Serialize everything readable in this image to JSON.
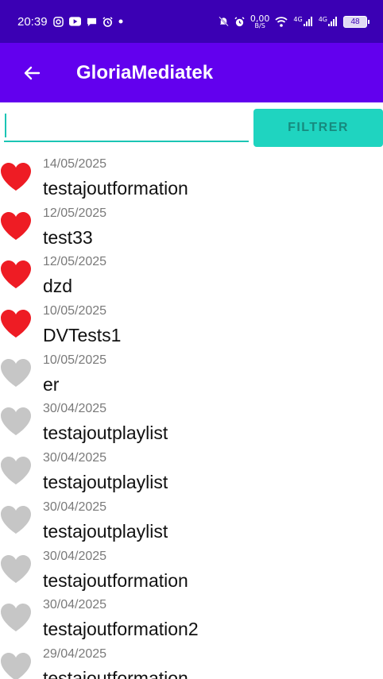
{
  "status_bar": {
    "time": "20:39",
    "left_icons": [
      "instagram-icon",
      "youtube-icon",
      "chat-icon",
      "alarm-icon",
      "dot-icon"
    ],
    "right_icons": [
      "mute-icon",
      "alarm-icon",
      "data-speed-icon",
      "wifi-icon",
      "signal-4g-icon",
      "signal-4g-icon"
    ],
    "data_speed_top": "0,00",
    "data_speed_bottom": "B/S",
    "network_1": "4G",
    "network_2": "4G",
    "battery": "48"
  },
  "app_bar": {
    "back_icon": "arrow-left-icon",
    "title": "GloriaMediatek",
    "color": "#6200ee"
  },
  "filter": {
    "input_value": "",
    "button_label": "FILTRER",
    "accent_color": "#1fd4c0"
  },
  "items": [
    {
      "date": "14/05/2025",
      "title": "testajoutformation",
      "favorite": true
    },
    {
      "date": "12/05/2025",
      "title": "test33",
      "favorite": true
    },
    {
      "date": "12/05/2025",
      "title": "dzd",
      "favorite": true
    },
    {
      "date": "10/05/2025",
      "title": "DVTests1",
      "favorite": true
    },
    {
      "date": "10/05/2025",
      "title": "er",
      "favorite": false
    },
    {
      "date": "30/04/2025",
      "title": "testajoutplaylist",
      "favorite": false
    },
    {
      "date": "30/04/2025",
      "title": "testajoutplaylist",
      "favorite": false
    },
    {
      "date": "30/04/2025",
      "title": "testajoutplaylist",
      "favorite": false
    },
    {
      "date": "30/04/2025",
      "title": "testajoutformation",
      "favorite": false
    },
    {
      "date": "30/04/2025",
      "title": "testajoutformation2",
      "favorite": false
    },
    {
      "date": "29/04/2025",
      "title": "testajoutformation",
      "favorite": false
    }
  ],
  "colors": {
    "heart_on": "#ee1c24",
    "heart_off": "#c6c6c6"
  }
}
